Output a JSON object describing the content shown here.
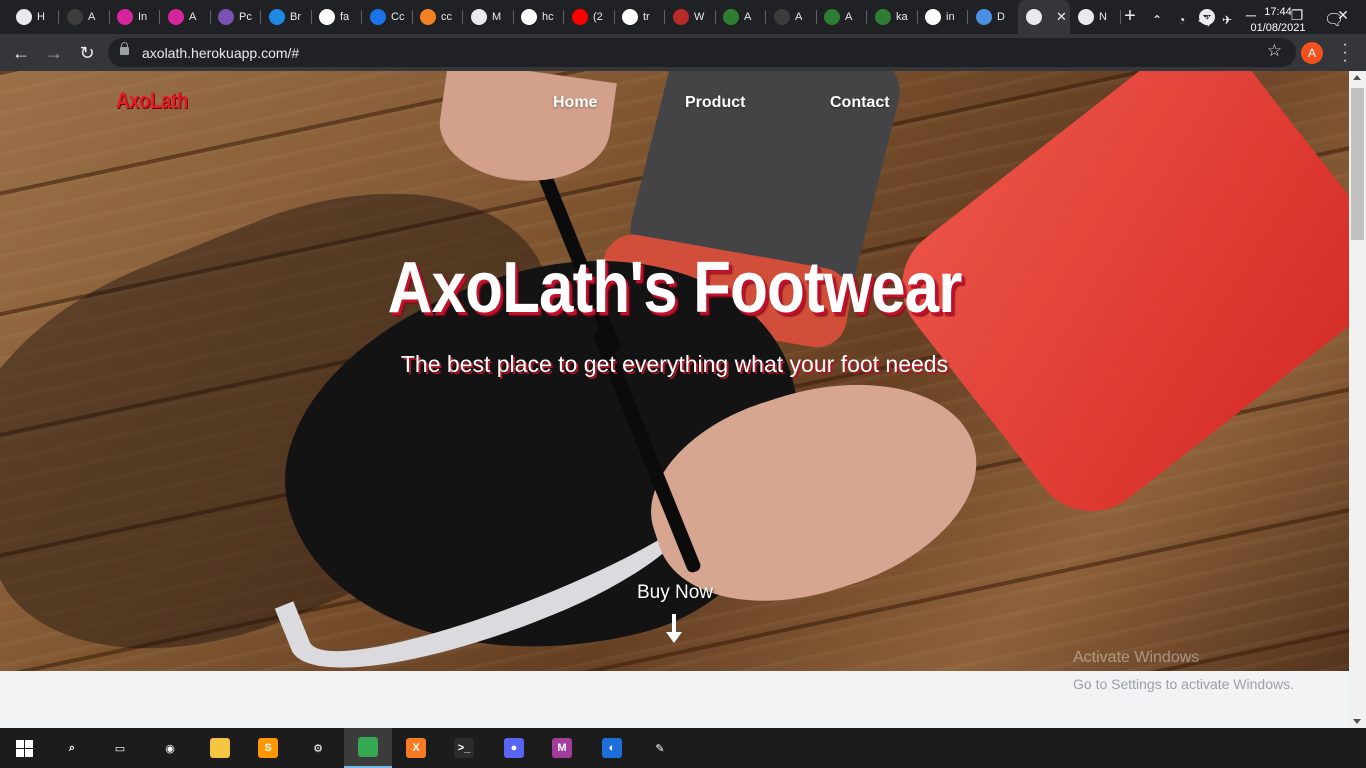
{
  "browser": {
    "tabs": [
      {
        "label": "H",
        "favicon": "globe-icon",
        "color": "#e8eaed"
      },
      {
        "label": "A",
        "favicon": "github-icon",
        "color": "#3c3c3c"
      },
      {
        "label": "In",
        "favicon": "instagram-icon",
        "color": "#d6249f"
      },
      {
        "label": "A",
        "favicon": "instagram-icon",
        "color": "#d6249f"
      },
      {
        "label": "Pc",
        "favicon": "bootstrap-icon",
        "color": "#7952b3"
      },
      {
        "label": "Br",
        "favicon": "brand-icon",
        "color": "#1e88e5"
      },
      {
        "label": "fa",
        "favicon": "flag-icon",
        "color": "#ffffff"
      },
      {
        "label": "Cc",
        "favicon": "c-icon",
        "color": "#1a73e8"
      },
      {
        "label": "cc",
        "favicon": "stackoverflow-icon",
        "color": "#f48024"
      },
      {
        "label": "M",
        "favicon": "globe-icon",
        "color": "#e8eaed"
      },
      {
        "label": "hc",
        "favicon": "google-icon",
        "color": "#ffffff"
      },
      {
        "label": "(2",
        "favicon": "youtube-icon",
        "color": "#ff0000"
      },
      {
        "label": "tr",
        "favicon": "google-icon",
        "color": "#ffffff"
      },
      {
        "label": "W",
        "favicon": "quora-icon",
        "color": "#b92b27"
      },
      {
        "label": "A",
        "favicon": "virus-icon",
        "color": "#2e7d32"
      },
      {
        "label": "A",
        "favicon": "github-icon",
        "color": "#3c3c3c"
      },
      {
        "label": "A",
        "favicon": "virus-icon",
        "color": "#2e7d32"
      },
      {
        "label": "ka",
        "favicon": "virus-icon",
        "color": "#2e7d32"
      },
      {
        "label": "in",
        "favicon": "google-icon",
        "color": "#ffffff"
      },
      {
        "label": "D",
        "favicon": "heart-icon",
        "color": "#4a90e2"
      },
      {
        "label": "",
        "favicon": "globe-icon",
        "color": "#e8eaed",
        "active": true
      },
      {
        "label": "N",
        "favicon": "chrome-icon",
        "color": "#e8eaed"
      }
    ],
    "url": "axolath.herokuapp.com/#",
    "profile_initial": "A"
  },
  "site": {
    "logo": "AxoLath",
    "nav": [
      "Home",
      "Product",
      "Contact"
    ],
    "hero_title": "AxoLath's Footwear",
    "hero_subtitle": "The best place to get everything what your foot needs",
    "cta": "Buy Now"
  },
  "system": {
    "watermark_title": "Activate Windows",
    "watermark_text": "Go to Settings to activate Windows.",
    "time": "17:44",
    "date": "01/08/2021",
    "taskbar_apps": [
      {
        "name": "search-icon",
        "glyph": "⌕",
        "color": "transparent"
      },
      {
        "name": "task-view-icon",
        "glyph": "▭",
        "color": "transparent"
      },
      {
        "name": "obs-icon",
        "glyph": "◉",
        "color": "transparent"
      },
      {
        "name": "file-explorer-icon",
        "glyph": "",
        "color": "#f4c542"
      },
      {
        "name": "sublime-text-icon",
        "glyph": "S",
        "color": "#ff9800"
      },
      {
        "name": "settings-icon",
        "glyph": "⚙",
        "color": "transparent"
      },
      {
        "name": "chrome-icon",
        "glyph": "",
        "color": "#34a853"
      },
      {
        "name": "xampp-icon",
        "glyph": "X",
        "color": "#fb7a24"
      },
      {
        "name": "terminal-icon",
        "glyph": ">_",
        "color": "#2b2b2b"
      },
      {
        "name": "discord-icon",
        "glyph": "●",
        "color": "#5865f2"
      },
      {
        "name": "mongodb-compass-icon",
        "glyph": "M",
        "color": "#a23d9c"
      },
      {
        "name": "app-blue-icon",
        "glyph": "◐",
        "color": "#1e6fd9"
      },
      {
        "name": "paint-icon",
        "glyph": "✎",
        "color": "transparent"
      }
    ]
  }
}
